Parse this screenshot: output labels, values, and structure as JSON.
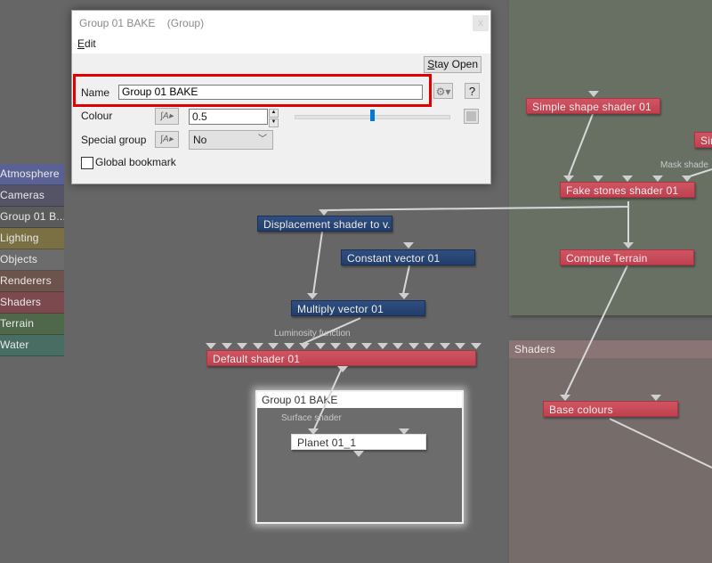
{
  "dialog": {
    "title": "Group 01 BAKE",
    "title_type": "(Group)",
    "close_label": "x",
    "menu": {
      "edit_label": "Edit",
      "edit_mnemonic": "E",
      "edit_rest": "dit"
    },
    "stay_open_label": "Stay Open",
    "stay_open_mnemonic": "S",
    "stay_open_rest": "tay Open",
    "name_label": "Name",
    "name_value": "Group 01 BAKE",
    "gear_icon": "⚙▾",
    "help_label": "?",
    "colour_label": "Colour",
    "colour_value": "0.5",
    "colour_slider_fraction": 0.5,
    "special_group_label": "Special group",
    "special_group_value": "No",
    "global_bookmark_label": "Global bookmark",
    "global_bookmark_checked": false,
    "fx_icon": "∫A▸"
  },
  "sidebar": {
    "items": [
      {
        "label": "Atmosphere",
        "color": "#5a6294"
      },
      {
        "label": "Cameras",
        "color": "#555366"
      },
      {
        "label": "Group 01 B...",
        "color": "#5b5b5b"
      },
      {
        "label": "Lighting",
        "color": "#7a7043"
      },
      {
        "label": "Objects",
        "color": "#6c6c6c"
      },
      {
        "label": "Renderers",
        "color": "#6c534b"
      },
      {
        "label": "Shaders",
        "color": "#7c4a4e"
      },
      {
        "label": "Terrain",
        "color": "#4f6849"
      },
      {
        "label": "Water",
        "color": "#486d62"
      }
    ]
  },
  "groups": {
    "shaders_title": "Shaders",
    "bake_title": "Group 01 BAKE"
  },
  "nodes": {
    "simple_shape": "Simple shape shader 01",
    "simple_shape_2": "Sir",
    "fake_stones": "Fake stones shader 01",
    "compute_terrain": "Compute Terrain",
    "displacement": "Displacement shader to v...",
    "constant_vector": "Constant vector 01",
    "multiply_vector": "Multiply vector 01",
    "default_shader": "Default shader 01",
    "base_colours": "Base colours",
    "planet": "Planet 01_1"
  },
  "port_labels": {
    "mask_shader": "Mask shade",
    "luminosity": "Luminosity function",
    "surface_shader": "Surface shader"
  }
}
